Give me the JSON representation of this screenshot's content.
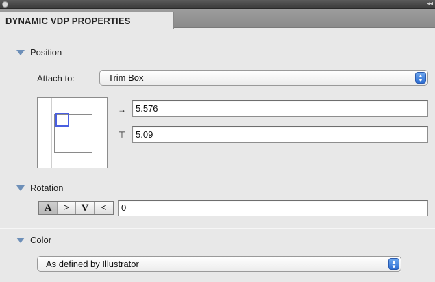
{
  "panel": {
    "tab_title": "DYNAMIC VDP PROPERTIES",
    "collapse_glyph": "◂◂"
  },
  "position": {
    "title": "Position",
    "attach_label": "Attach to:",
    "attach_value": "Trim Box",
    "x_icon": "→",
    "x_value": "5.576",
    "y_icon": "⊤",
    "y_value": "5.09"
  },
  "rotation": {
    "title": "Rotation",
    "buttons": [
      "A",
      ">",
      "V",
      "<"
    ],
    "selected_index": 0,
    "value": "0"
  },
  "color": {
    "title": "Color",
    "value": "As defined by Illustrator"
  },
  "icons": {
    "disclosure": "disclosure-triangle-icon",
    "popup": "up-down-arrows-icon"
  },
  "colors": {
    "accent": "#3a78dc",
    "marker": "#4a5fe0",
    "disclosure": "#6d8fb8"
  }
}
